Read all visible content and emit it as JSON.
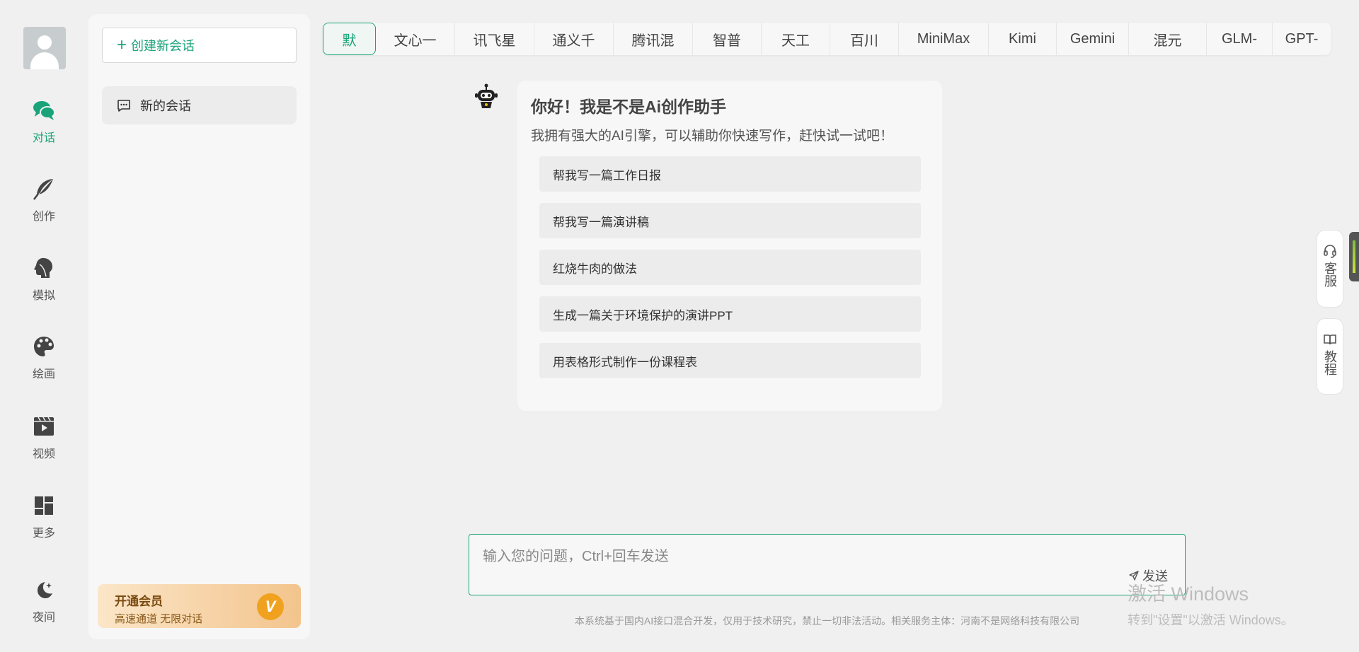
{
  "nav": {
    "items": [
      {
        "label": "对话",
        "icon": "chat-bubbles-icon",
        "active": true
      },
      {
        "label": "创作",
        "icon": "feather-icon",
        "active": false
      },
      {
        "label": "模拟",
        "icon": "head-profile-icon",
        "active": false
      },
      {
        "label": "绘画",
        "icon": "palette-icon",
        "active": false
      },
      {
        "label": "视频",
        "icon": "video-icon",
        "active": false
      },
      {
        "label": "更多",
        "icon": "grid-icon",
        "active": false
      },
      {
        "label": "夜间",
        "icon": "moon-icon",
        "active": false
      }
    ],
    "accent": "#1aa37a"
  },
  "sidebar": {
    "new_chat_label": "创建新会话",
    "sessions": [
      {
        "title": "新的会话"
      }
    ],
    "vip": {
      "title": "开通会员",
      "subtitle": "高速通道 无限对话",
      "badge": "V"
    }
  },
  "model_tabs": [
    {
      "label": "默",
      "active": true
    },
    {
      "label": "文心一",
      "active": false
    },
    {
      "label": "讯飞星",
      "active": false
    },
    {
      "label": "通义千",
      "active": false
    },
    {
      "label": "腾讯混",
      "active": false
    },
    {
      "label": "智普",
      "active": false
    },
    {
      "label": "天工",
      "active": false
    },
    {
      "label": "百川",
      "active": false
    },
    {
      "label": "MiniMax",
      "active": false
    },
    {
      "label": "Kimi",
      "active": false
    },
    {
      "label": "Gemini",
      "active": false
    },
    {
      "label": "混元",
      "active": false
    },
    {
      "label": "GLM-",
      "active": false
    },
    {
      "label": "GPT-",
      "active": false
    }
  ],
  "welcome": {
    "title": "你好！我是不是Ai创作助手",
    "subtitle": "我拥有强大的AI引擎，可以辅助你快速写作，赶快试一试吧！",
    "suggestions": [
      "帮我写一篇工作日报",
      "帮我写一篇演讲稿",
      "红烧牛肉的做法",
      "生成一篇关于环境保护的演讲PPT",
      "用表格形式制作一份课程表"
    ]
  },
  "input": {
    "placeholder": "输入您的问题，Ctrl+回车发送",
    "send_label": "发送"
  },
  "footer": "本系统基于国内AI接口混合开发，仅用于技术研究，禁止一切非法活动。相关服务主体：河南不是网络科技有限公司",
  "float_buttons": [
    {
      "label": "客服",
      "icon": "headset-icon"
    },
    {
      "label": "教程",
      "icon": "book-icon"
    }
  ],
  "watermark": {
    "line1": "激活 Windows",
    "line2": "转到\"设置\"以激活 Windows。"
  }
}
